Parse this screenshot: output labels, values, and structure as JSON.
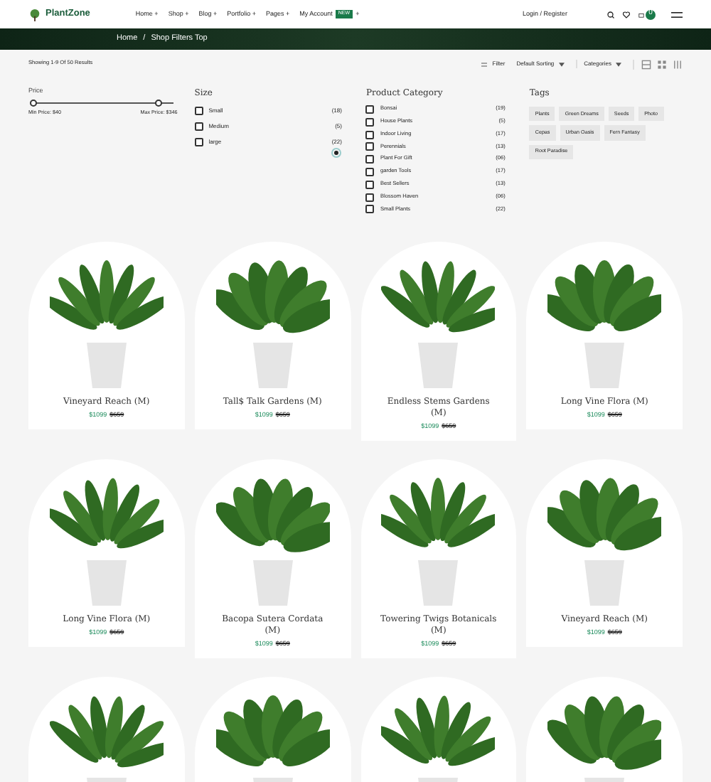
{
  "header": {
    "logo": "PlantZone",
    "nav": [
      {
        "label": "Home +"
      },
      {
        "label": "Shop +"
      },
      {
        "label": "Blog +"
      },
      {
        "label": "Portfolio +"
      },
      {
        "label": "Pages +"
      },
      {
        "label": "My Account",
        "badge": "NEW",
        "suffix": "+"
      }
    ],
    "login": "Login / Register",
    "cart_count": "0"
  },
  "breadcrumb": [
    "Home",
    "/",
    "Shop Filters Top"
  ],
  "toolbar": {
    "results": "Showing 1-9 Of 50 Results",
    "filter": "Filter",
    "sorting": "Default Sorting",
    "categories": "Categories",
    "views": [
      {
        "kind": "list",
        "selected": false
      },
      {
        "kind": "grid",
        "selected": false
      },
      {
        "kind": "columns",
        "selected": false
      }
    ]
  },
  "price": {
    "title": "Price",
    "handles": [
      {
        "level": 0
      },
      {
        "level": 0.9
      }
    ],
    "min_label": "Min Price: $40",
    "max_label": "Max Price: $346"
  },
  "size": {
    "title": "Size",
    "items": [
      {
        "label": "Small",
        "count": "(18)",
        "checked": false
      },
      {
        "label": "Medium",
        "count": "(5)",
        "checked": false
      },
      {
        "label": "large",
        "count": "(22)",
        "checked": false
      }
    ]
  },
  "category": {
    "title": "Product Category",
    "items": [
      {
        "label": "Bonsai",
        "count": "(19)",
        "checked": false
      },
      {
        "label": "House Plants",
        "count": "(5)",
        "checked": false
      },
      {
        "label": "Indoor Living",
        "count": "(17)",
        "checked": false
      },
      {
        "label": "Perennials",
        "count": "(13)",
        "checked": false
      },
      {
        "label": "Plant For Gift",
        "count": "(06)",
        "checked": false
      },
      {
        "label": "garden Tools",
        "count": "(17)",
        "checked": false
      },
      {
        "label": "Best Sellers",
        "count": "(13)",
        "checked": false
      },
      {
        "label": "Blossom Haven",
        "count": "(06)",
        "checked": false
      },
      {
        "label": "Small Plants",
        "count": "(22)",
        "checked": false
      }
    ]
  },
  "tags": {
    "title": "Tags",
    "items": [
      "Plants",
      "Green Dreams",
      "Seeds",
      "Photo",
      "Cepas",
      "Urban Oasis",
      "Fern Fantasy",
      "Root Paradise"
    ]
  },
  "products": [
    {
      "kind": "full",
      "name": "Vineyard Reach (M)",
      "price": "$1099",
      "old_price": "$659"
    },
    {
      "kind": "full",
      "name": "Tall$ Talk Gardens (M)",
      "price": "$1099",
      "old_price": "$659"
    },
    {
      "kind": "full",
      "name": "Endless Stems Gardens (M)",
      "price": "$1099",
      "old_price": "$659"
    },
    {
      "kind": "full",
      "name": "Long Vine Flora (M)",
      "price": "$1099",
      "old_price": "$659"
    },
    {
      "kind": "full",
      "name": "Long Vine Flora (M)",
      "price": "$1099",
      "old_price": "$659"
    },
    {
      "kind": "full",
      "name": "Bacopa Sutera Cordata (M)",
      "price": "$1099",
      "old_price": "$659"
    },
    {
      "kind": "full",
      "name": "Towering Twigs Botanicals (M)",
      "price": "$1099",
      "old_price": "$659"
    },
    {
      "kind": "full",
      "name": "Vineyard Reach (M)",
      "price": "$1099",
      "old_price": "$659"
    },
    {
      "kind": "image_only"
    },
    {
      "kind": "image_only"
    },
    {
      "kind": "image_only"
    },
    {
      "kind": "image_only"
    }
  ]
}
